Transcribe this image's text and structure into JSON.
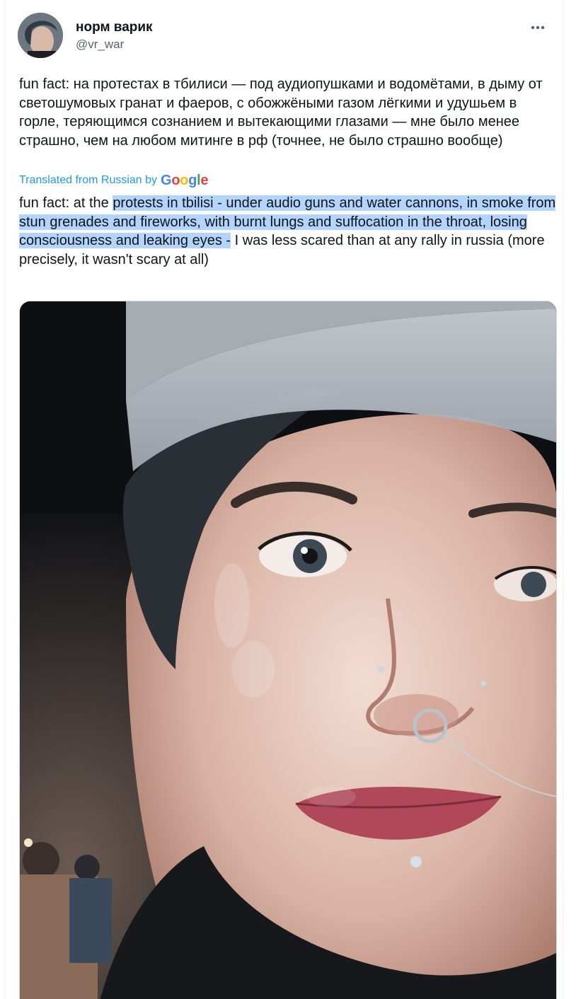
{
  "tweet": {
    "display_name": "норм варик",
    "handle": "@vr_war",
    "more_label": "More",
    "original_text": "fun fact: на протестах в тбилиси — под аудиопушками и водомётами, в дыму от светошумовых гранат и фаеров, с обожжёными газом лёгкими и удушьем в горле, теряющимся сознанием и вытекающими глазами — мне было менее страшно, чем на любом митинге в рф (точнее, не было страшно вообще)",
    "translated_by_label": "Translated from Russian by",
    "google_letters": [
      "G",
      "o",
      "o",
      "g",
      "l",
      "e"
    ],
    "translation": {
      "before_highlight": "fun fact: at the ",
      "highlighted": "protests in tbilisi - under audio guns and water cannons, in smoke from stun grenades and fireworks, with burnt lungs and suffocation in the throat, losing consciousness and leaking eyes -",
      "after_highlight": " I was less scared than at any rally in russia (more precisely, it wasn't scary at all)"
    },
    "media": {
      "icon": "photo"
    }
  },
  "colors": {
    "text_primary": "#0f1419",
    "text_secondary": "#536471",
    "link_blue": "#1d9bf0",
    "selection": "#b3d4fc"
  }
}
